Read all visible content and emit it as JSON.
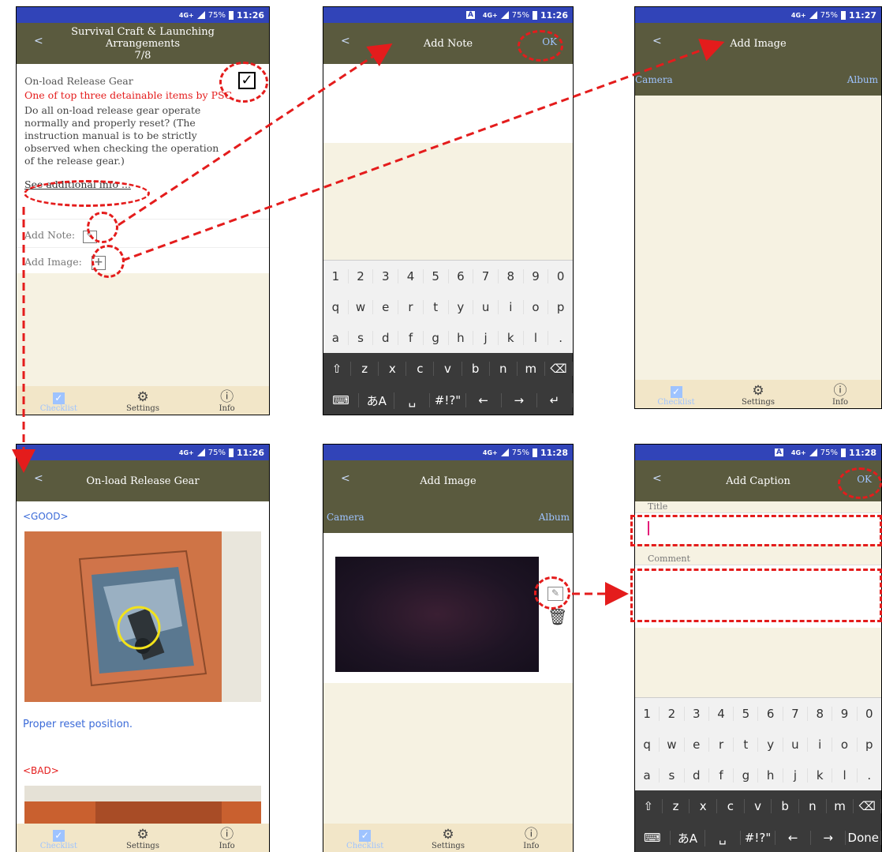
{
  "status": {
    "net": "4G+",
    "battery": "75%",
    "akey": "A",
    "times": [
      "11:26",
      "11:26",
      "11:27",
      "11:26",
      "11:28",
      "11:28"
    ]
  },
  "screen1": {
    "back": "<",
    "title_line1": "Survival Craft & Launching",
    "title_line2": "Arrangements",
    "title_line3": "7/8",
    "item_title": "On-load Release Gear",
    "warning": "One of top three detainable items by PSC",
    "description": "Do all on-load release gear operate normally and properly reset? (The instruction manual is to be strictly observed when checking the operation of the release gear.)",
    "link": "See additional info ...",
    "add_note": "Add Note:",
    "add_image": "Add Image:",
    "check": "✓"
  },
  "screen2": {
    "back": "<",
    "title": "Add Note",
    "ok": "OK"
  },
  "screen3": {
    "back": "<",
    "title": "Add Image",
    "camera": "Camera",
    "album": "Album"
  },
  "screen4": {
    "back": "<",
    "title": "On-load Release Gear",
    "good": "<GOOD>",
    "good_caption": "Proper reset position.",
    "bad": "<BAD>"
  },
  "screen5": {
    "back": "<",
    "title": "Add Image",
    "camera": "Camera",
    "album": "Album"
  },
  "screen6": {
    "back": "<",
    "title": "Add Caption",
    "ok": "OK",
    "title_label": "Title",
    "comment_label": "Comment"
  },
  "tabs": {
    "checklist": "Checklist",
    "settings": "Settings",
    "info": "Info"
  },
  "keyboard": {
    "row1": [
      "1",
      "2",
      "3",
      "4",
      "5",
      "6",
      "7",
      "8",
      "9",
      "0"
    ],
    "row2": [
      "q",
      "w",
      "e",
      "r",
      "t",
      "y",
      "u",
      "i",
      "o",
      "p"
    ],
    "row3": [
      "a",
      "s",
      "d",
      "f",
      "g",
      "h",
      "j",
      "k",
      "l",
      "."
    ],
    "row4": [
      "⇧",
      "z",
      "x",
      "c",
      "v",
      "b",
      "n",
      "m",
      "⌫"
    ],
    "row5": [
      "⌨",
      "あA",
      "␣",
      "#!?\"",
      "←",
      "→",
      "↵"
    ],
    "done": "Done"
  },
  "colors": {
    "appbar": "#5a5a3e",
    "status": "#3144b8",
    "accent_red": "#e41c1c",
    "link_blue": "#9ec3ff",
    "body_bg": "#f6f2e2"
  }
}
